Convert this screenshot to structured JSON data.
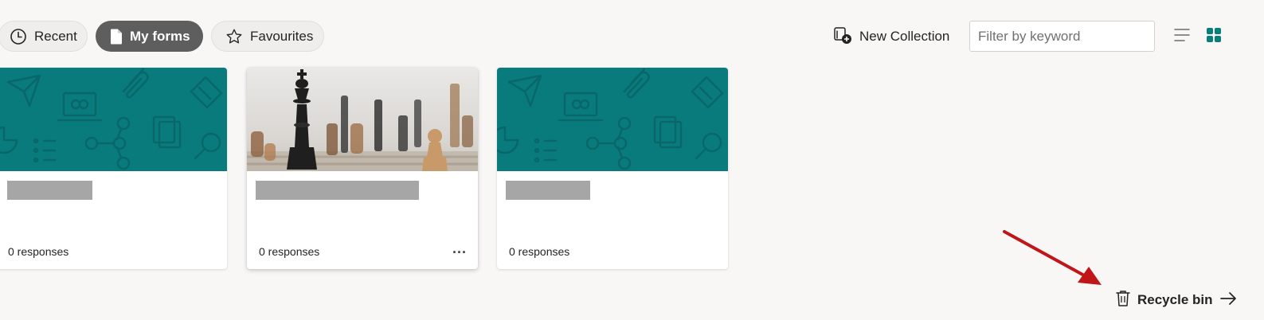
{
  "tabs": [
    {
      "label": "Recent",
      "icon": "clock-icon",
      "active": false
    },
    {
      "label": "My forms",
      "icon": "document-icon",
      "active": true
    },
    {
      "label": "Favourites",
      "icon": "star-icon",
      "active": false
    }
  ],
  "toolbar": {
    "new_collection_label": "New Collection",
    "filter_placeholder": "Filter by keyword",
    "list_view_icon": "list-view-icon",
    "grid_view_icon": "grid-view-icon"
  },
  "forms": [
    {
      "title": "",
      "responses": "0 responses",
      "banner": "teal-pattern"
    },
    {
      "title": "",
      "responses": "0 responses",
      "banner": "chess-photo",
      "more_label": "..."
    },
    {
      "title": "",
      "responses": "0 responses",
      "banner": "teal-pattern"
    }
  ],
  "footer": {
    "recycle_bin_label": "Recycle bin"
  },
  "colors": {
    "teal_banner": "#097b7c",
    "active_pill": "#5e5e5e",
    "grid_accent": "#077f7b",
    "annotation_arrow": "#c0161a"
  }
}
